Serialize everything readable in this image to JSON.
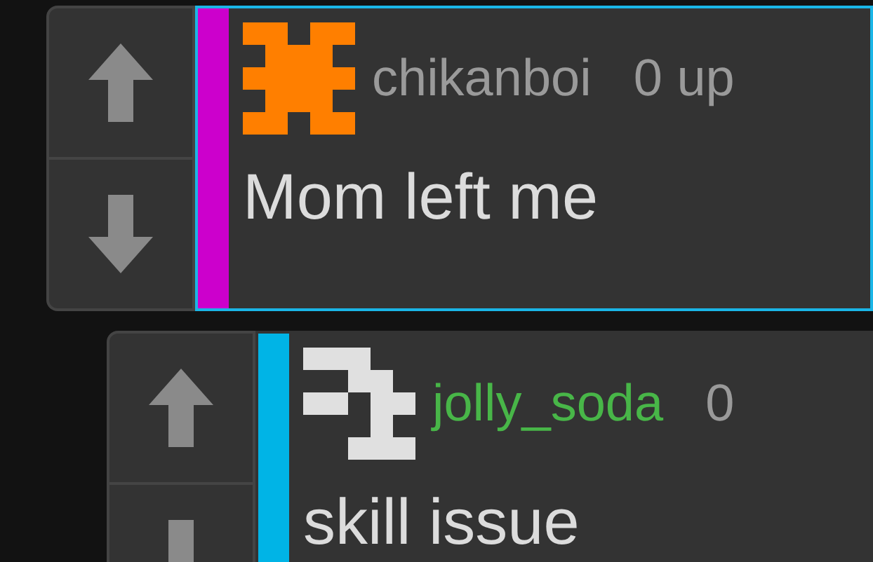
{
  "comments": [
    {
      "username": "chikanboi",
      "score": "0 up",
      "text": "Mom left me",
      "color": "#cc00cc",
      "selected": true,
      "children": [
        {
          "username": "jolly_soda",
          "score": "0",
          "text": "skill issue",
          "color": "#00b4e6",
          "selected": false
        }
      ]
    }
  ]
}
